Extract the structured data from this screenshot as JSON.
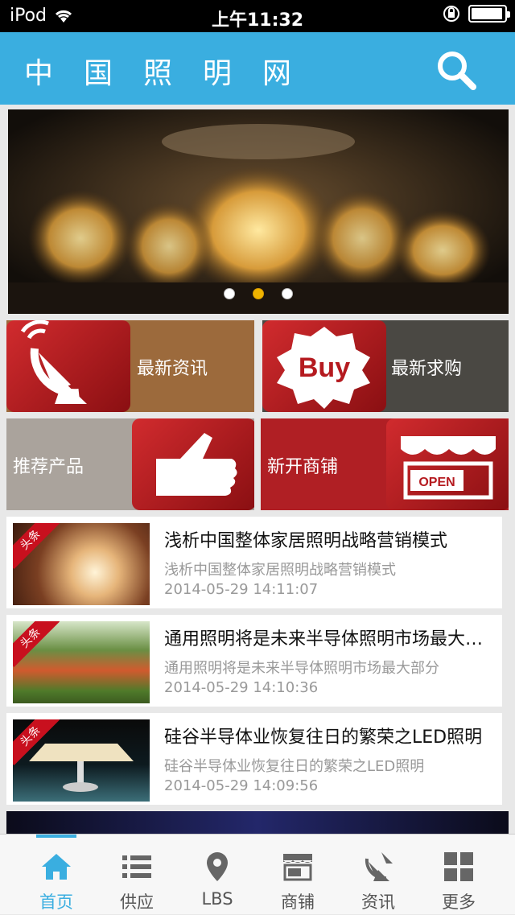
{
  "status_bar": {
    "carrier": "iPod",
    "time": "上午11:32"
  },
  "header": {
    "title": "中国照明网",
    "search_icon": "search-icon"
  },
  "banner": {
    "dots": 3,
    "active_dot": 2
  },
  "tiles": [
    {
      "label": "最新资讯",
      "icon": "satellite-dish-icon",
      "color": "#9c6a3c"
    },
    {
      "label": "最新求购",
      "icon": "buy-badge-icon",
      "color": "#4a4843"
    },
    {
      "label": "推荐产品",
      "icon": "thumbs-up-icon",
      "color": "#aaa39c"
    },
    {
      "label": "新开商铺",
      "icon": "open-store-icon",
      "color": "#b01f24"
    }
  ],
  "news": [
    {
      "badge": "头条",
      "title": "浅析中国整体家居照明战略营销模式",
      "summary": "浅析中国整体家居照明战略营销模式",
      "date": "2014-05-29 14:11:07"
    },
    {
      "badge": "头条",
      "title": "通用照明将是未来半导体照明市场最大部分",
      "summary": "通用照明将是未来半导体照明市场最大部分",
      "date": "2014-05-29 14:10:36"
    },
    {
      "badge": "头条",
      "title": "硅谷半导体业恢复往日的繁荣之LED照明",
      "summary": "硅谷半导体业恢复往日的繁荣之LED照明",
      "date": "2014-05-29 14:09:56"
    }
  ],
  "tabbar": [
    {
      "label": "首页",
      "icon": "home-icon",
      "active": true
    },
    {
      "label": "供应",
      "icon": "list-icon",
      "active": false
    },
    {
      "label": "LBS",
      "icon": "location-pin-icon",
      "active": false
    },
    {
      "label": "商铺",
      "icon": "store-icon",
      "active": false
    },
    {
      "label": "资讯",
      "icon": "news-icon",
      "active": false
    },
    {
      "label": "更多",
      "icon": "grid-icon",
      "active": false
    }
  ]
}
